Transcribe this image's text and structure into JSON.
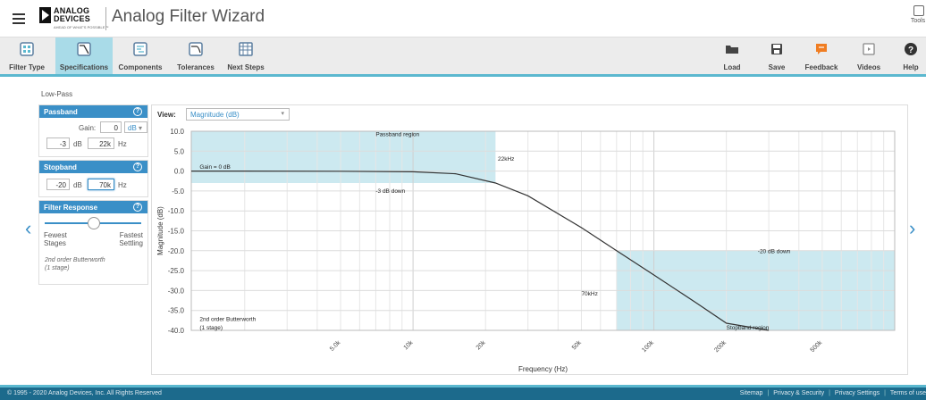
{
  "header": {
    "logo_line1": "ANALOG",
    "logo_line2": "DEVICES",
    "logo_tagline": "AHEAD OF WHAT'S POSSIBLE™",
    "title": "Analog Filter Wizard",
    "tools_label": "Tools"
  },
  "toolbar": {
    "left_items": [
      {
        "label": "Filter Type",
        "icon": "filter-type-icon"
      },
      {
        "label": "Specifications",
        "icon": "specifications-icon",
        "active": true
      },
      {
        "label": "Components",
        "icon": "components-icon"
      },
      {
        "label": "Tolerances",
        "icon": "tolerances-icon"
      },
      {
        "label": "Next Steps",
        "icon": "next-steps-icon"
      }
    ],
    "right_items": [
      {
        "label": "Load",
        "icon": "folder-icon"
      },
      {
        "label": "Save",
        "icon": "save-icon"
      },
      {
        "label": "Feedback",
        "icon": "feedback-icon"
      },
      {
        "label": "Videos",
        "icon": "videos-icon"
      },
      {
        "label": "Help",
        "icon": "help-icon"
      }
    ],
    "accent_color": "#5bb8cf",
    "active_bg": "#a9dbe8"
  },
  "filter_type_label": "Low-Pass",
  "passband": {
    "title": "Passband",
    "help": "?",
    "gain_label": "Gain:",
    "gain_value": "0",
    "gain_unit": "dB",
    "atten_value": "-3",
    "atten_unit": "dB",
    "freq_value": "22k",
    "freq_unit": "Hz"
  },
  "stopband": {
    "title": "Stopband",
    "help": "?",
    "atten_value": "-20",
    "atten_unit": "dB",
    "freq_value": "70k",
    "freq_unit": "Hz"
  },
  "filter_response": {
    "title": "Filter Response",
    "help": "?",
    "left_line1": "Fewest",
    "left_line2": "Stages",
    "right_line1": "Fastest",
    "right_line2": "Settling",
    "slider_position": 0.5,
    "summary_line1": "2nd order Butterworth",
    "summary_line2": "(1 stage)"
  },
  "nav": {
    "prev": "‹",
    "next": "›"
  },
  "view": {
    "label": "View:",
    "selected": "Magnitude (dB)"
  },
  "chart_data": {
    "type": "line",
    "xscale": "log",
    "xlabel": "Frequency (Hz)",
    "ylabel": "Magnitude (dB)",
    "xlim": [
      1200,
      1000000
    ],
    "ylim": [
      -40,
      10
    ],
    "yticks": [
      "10.0",
      "5.0",
      "0.0",
      "-5.0",
      "-10.0",
      "-15.0",
      "-20.0",
      "-25.0",
      "-30.0",
      "-35.0",
      "-40.0"
    ],
    "xticks": [
      {
        "value": 5000,
        "label": "5.0k"
      },
      {
        "value": 10000,
        "label": "10k"
      },
      {
        "value": 20000,
        "label": "20k"
      },
      {
        "value": 50000,
        "label": "50k"
      },
      {
        "value": 100000,
        "label": "100k"
      },
      {
        "value": 200000,
        "label": "200k"
      },
      {
        "value": 500000,
        "label": "500k"
      }
    ],
    "grid": true,
    "series": [
      {
        "color": "#333333",
        "x": [
          1200,
          2000,
          5000,
          10000,
          15000,
          22000,
          30000,
          50000,
          70000,
          100000,
          150000,
          200000,
          300000
        ],
        "y": [
          0,
          0,
          -0.05,
          -0.17,
          -0.68,
          -3.0,
          -6.2,
          -14.2,
          -20.0,
          -26.1,
          -33.1,
          -38.2,
          -40
        ]
      }
    ],
    "regions": [
      {
        "name": "passband",
        "x": [
          1200,
          22000
        ],
        "y": [
          -3,
          10
        ]
      },
      {
        "name": "stopband",
        "x": [
          70000,
          1000000
        ],
        "y": [
          -40,
          -20
        ]
      }
    ],
    "region_color": "#cce9f0",
    "annotations": [
      {
        "text": "Passband region",
        "x": 7000,
        "y": 8.8
      },
      {
        "text": "22kHz",
        "x": 22500,
        "y": 2.6
      },
      {
        "text": "Gain = 0 dB",
        "x": 1300,
        "y": 0.6
      },
      {
        "text": "-3 dB down",
        "x": 7000,
        "y": -5.5
      },
      {
        "text": "-20 dB down",
        "x": 270000,
        "y": -20.6
      },
      {
        "text": "70kHz",
        "x": 50000,
        "y": -31.2
      },
      {
        "text": "2nd order Butterworth",
        "x": 1300,
        "y": -37.6
      },
      {
        "text": "(1 stage)",
        "x": 1300,
        "y": -39.8
      },
      {
        "text": "Stopband region",
        "x": 200000,
        "y": -39.8
      }
    ]
  },
  "footer": {
    "copyright": "© 1995 - 2020 Analog Devices, Inc. All Rights Reserved",
    "links": [
      "Sitemap",
      "Privacy & Security",
      "Privacy Settings",
      "Terms of use"
    ]
  }
}
